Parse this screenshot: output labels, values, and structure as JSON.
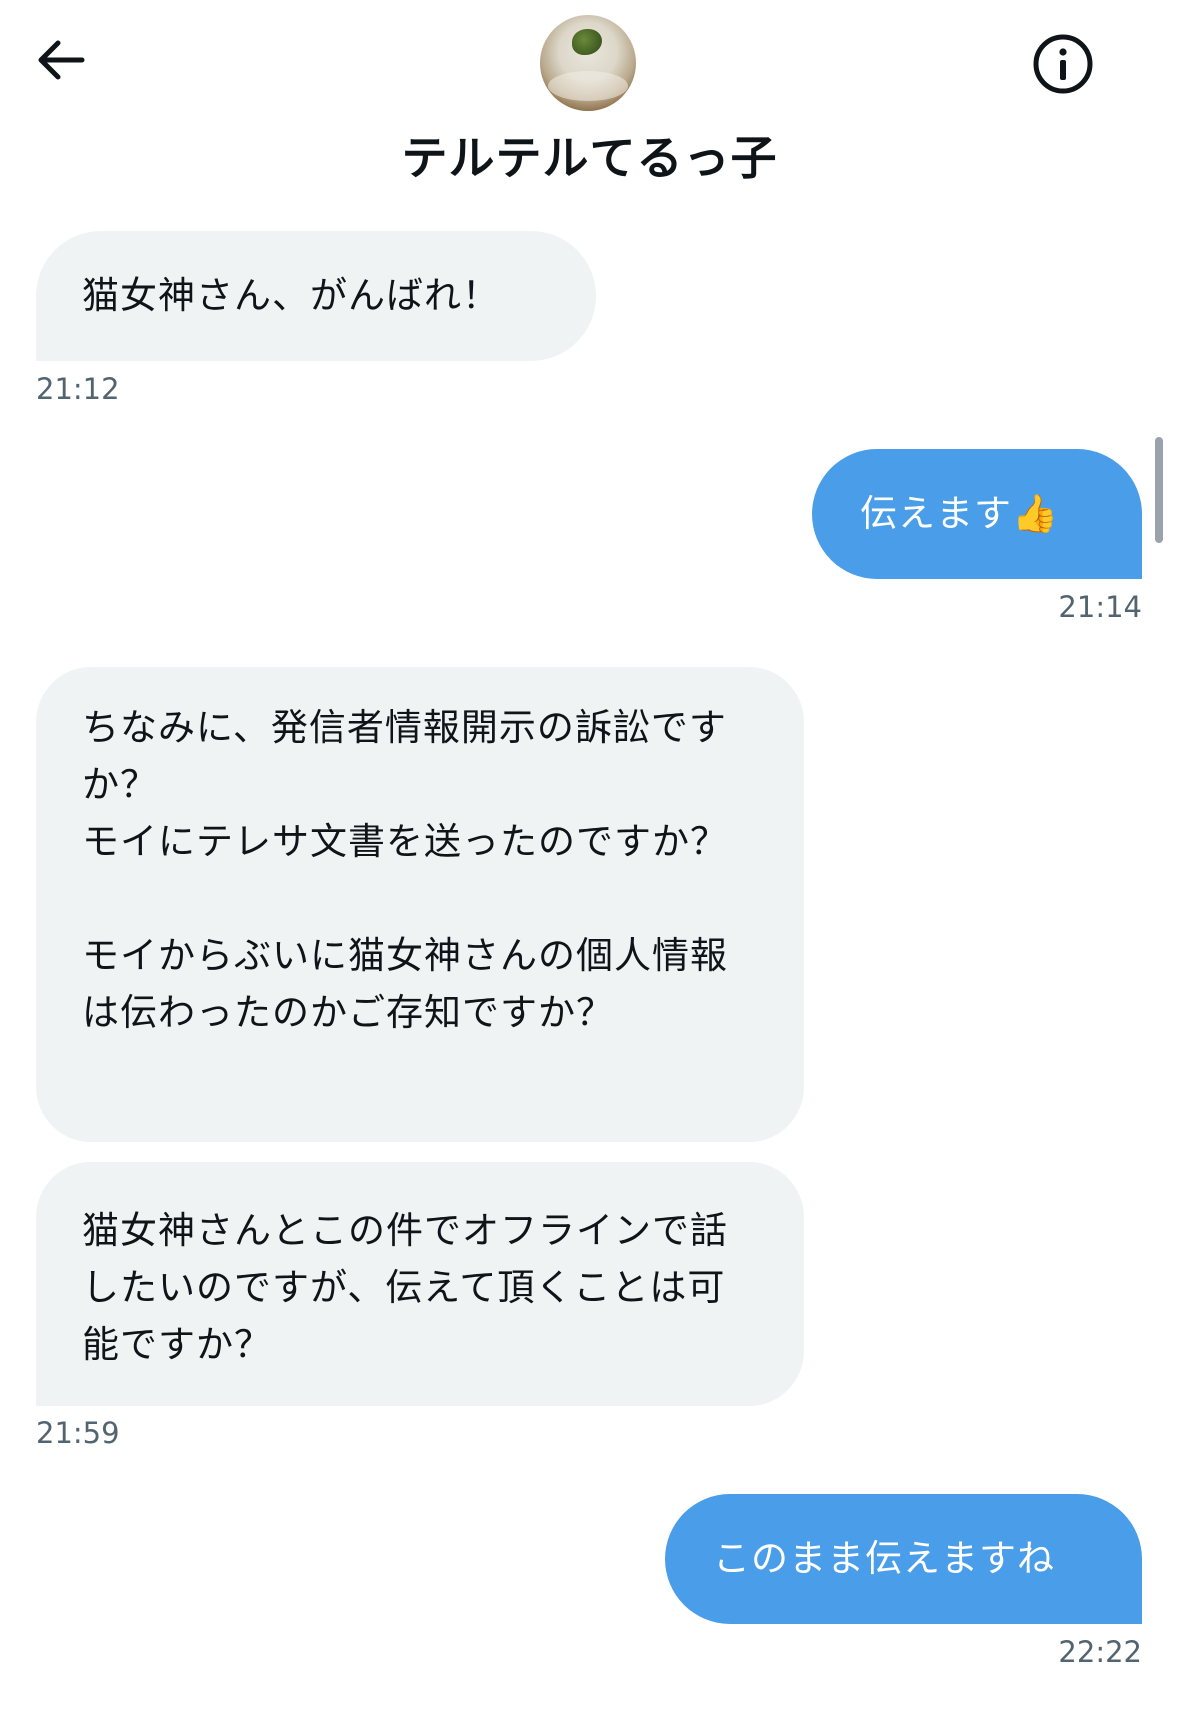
{
  "header": {
    "contact_name": "テルテルてるっ子",
    "back_icon": "arrow-left-icon",
    "info_icon": "info-circle-icon"
  },
  "messages": [
    {
      "direction": "incoming",
      "text": "猫女神さん、がんばれ！",
      "time": "21:12"
    },
    {
      "direction": "outgoing",
      "text": "伝えます👍",
      "time": "21:14"
    },
    {
      "direction": "incoming",
      "text": "ちなみに、発信者情報開示の訴訟ですか？\nモイにテレサ文書を送ったのですか？\n\nモイからぶいに猫女神さんの個人情報は伝わったのかご存知ですか？"
    },
    {
      "direction": "incoming",
      "text": "猫女神さんとこの件でオフラインで話したいのですが、伝えて頂くことは可能ですか？",
      "time": "21:59"
    },
    {
      "direction": "outgoing",
      "text": "このまま伝えますね",
      "time": "22:22"
    }
  ],
  "colors": {
    "outgoing_bubble": "#4a9de8",
    "incoming_bubble": "#eff3f4",
    "timestamp": "#536471"
  }
}
